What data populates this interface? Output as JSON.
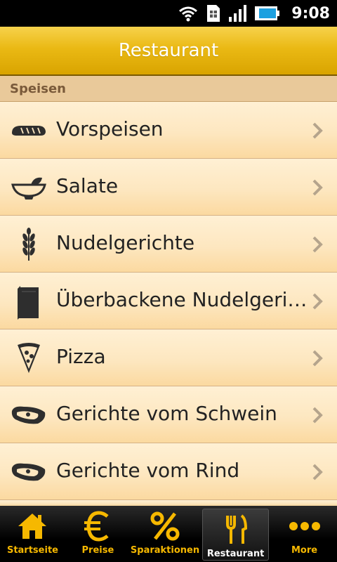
{
  "status_bar": {
    "time": "9:08",
    "icons": [
      "wifi-icon",
      "sim-card-icon",
      "signal-icon",
      "battery-icon"
    ]
  },
  "title_bar": {
    "title": "Restaurant"
  },
  "section": {
    "title": "Speisen"
  },
  "menu": {
    "items": [
      {
        "label": "Vorspeisen",
        "icon": "bread-icon"
      },
      {
        "label": "Salate",
        "icon": "salad-bowl-icon"
      },
      {
        "label": "Nudelgerichte",
        "icon": "wheat-icon"
      },
      {
        "label": "Überbackene Nudelgeri…",
        "icon": "lasagna-icon"
      },
      {
        "label": "Pizza",
        "icon": "pizza-slice-icon"
      },
      {
        "label": "Gerichte vom Schwein",
        "icon": "steak-icon"
      },
      {
        "label": "Gerichte vom Rind",
        "icon": "steak-icon"
      }
    ]
  },
  "tab_bar": {
    "tabs": [
      {
        "label": "Startseite",
        "icon": "home-icon"
      },
      {
        "label": "Preise",
        "icon": "euro-icon"
      },
      {
        "label": "Sparaktionen",
        "icon": "percent-icon"
      },
      {
        "label": "Restaurant",
        "icon": "fork-knife-icon",
        "active": true
      },
      {
        "label": "More",
        "icon": "more-dots-icon"
      }
    ]
  },
  "colors": {
    "accent": "#f6b800",
    "title_bar": "#eab914",
    "row_background": "#fde7c0",
    "section_background": "#e9c99a"
  }
}
